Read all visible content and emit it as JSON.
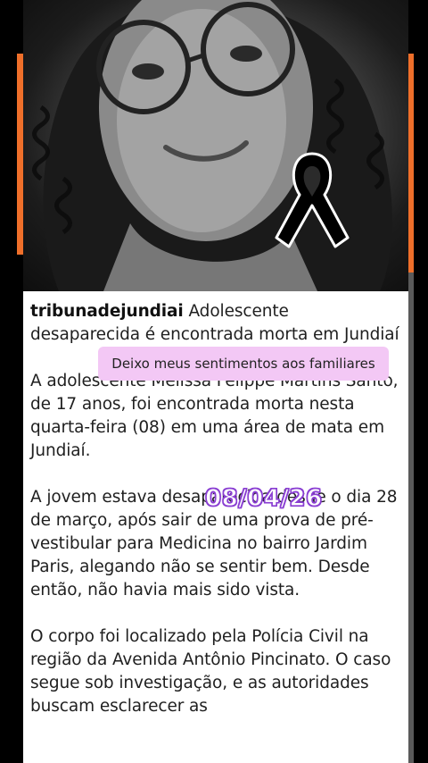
{
  "post": {
    "username": "tribunadejundiai",
    "headline": " Adolescente desaparecida é encontrada morta em Jundiaí",
    "paragraphs": [
      "A adolescente Melissa Felippe Martins Santo, de 17 anos, foi encontrada morta nesta quarta-feira (08) em uma área de mata em Jundiaí.",
      "A jovem estava desaparecida desde o dia 28 de março, após sair de uma prova de pré-vestibular para Medicina no bairro Jardim Paris, alegando não se sentir bem. Desde então, não havia mais sido vista.",
      "O corpo foi localizado pela Polícia Civil na região da Avenida Antônio Pincinato. O caso segue sob investigação, e as autoridades buscam esclarecer as"
    ]
  },
  "stickers": {
    "condolence": "Deixo meus sentimentos aos familiares",
    "date": "08/04/26"
  },
  "icons": {
    "mourning_ribbon": "black-ribbon-icon"
  },
  "colors": {
    "frame_accent": "#ef6f2a",
    "sticker_bg": "#f3c8f5",
    "date_outline": "#8a3fd1"
  }
}
